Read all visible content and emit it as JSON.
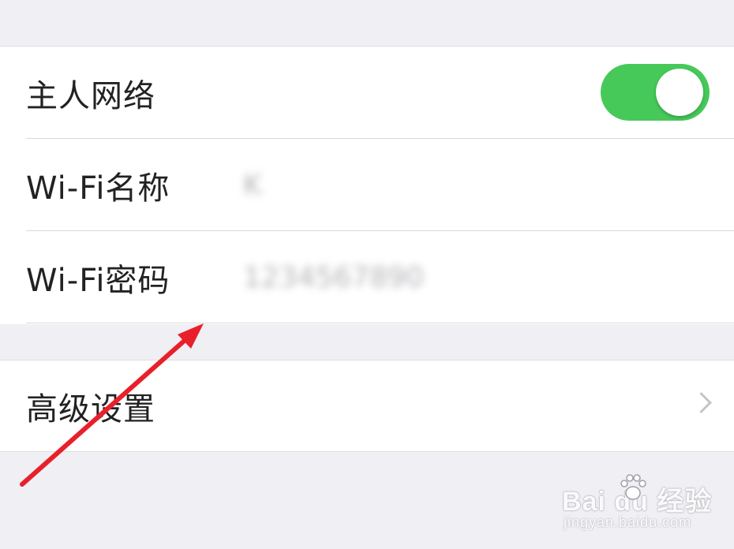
{
  "network": {
    "host_network": {
      "label": "主人网络",
      "enabled": true
    },
    "wifi_name": {
      "label": "Wi-Fi名称",
      "value": "K"
    },
    "wifi_password": {
      "label": "Wi-Fi密码",
      "value": "1234567890"
    }
  },
  "advanced": {
    "label": "高级设置"
  },
  "colors": {
    "toggle_on": "#47c95a",
    "annotation_arrow": "#e8202a"
  },
  "watermark": {
    "brand": "Bai du 经验",
    "url": "jingyan.baidu.com"
  }
}
